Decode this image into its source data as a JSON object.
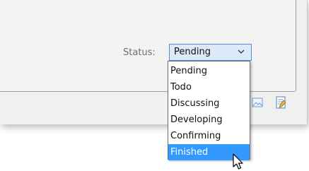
{
  "status_field": {
    "label": "Status:",
    "selected_value": "Pending"
  },
  "dropdown": {
    "options": [
      {
        "label": "Pending",
        "highlighted": false
      },
      {
        "label": "Todo",
        "highlighted": false
      },
      {
        "label": "Discussing",
        "highlighted": false
      },
      {
        "label": "Developing",
        "highlighted": false
      },
      {
        "label": "Confirming",
        "highlighted": false
      },
      {
        "label": "Finished",
        "highlighted": true
      }
    ]
  },
  "toolbar": {
    "icons": [
      "image-icon",
      "edit-document-icon"
    ]
  },
  "colors": {
    "select_border": "#4f8fd9",
    "select_fill": "#dde9f8",
    "highlight": "#3399ff",
    "label_text": "#6d6d6d"
  },
  "pointer": "arrow-cursor-icon"
}
